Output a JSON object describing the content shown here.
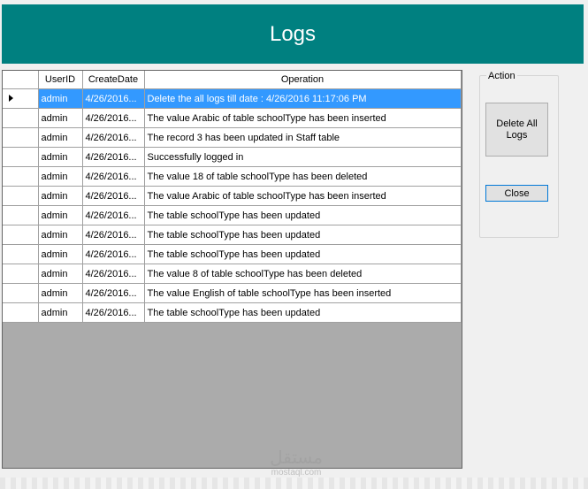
{
  "window": {
    "title": "Logs"
  },
  "grid": {
    "columns": [
      "UserID",
      "CreateDate",
      "Operation"
    ],
    "rows": [
      [
        "admin",
        "4/26/2016...",
        "Delete the all logs till date : 4/26/2016 11:17:06 PM"
      ],
      [
        "admin",
        "4/26/2016...",
        "The value Arabic of table schoolType has been inserted"
      ],
      [
        "admin",
        "4/26/2016...",
        "The record 3 has been updated in Staff table"
      ],
      [
        "admin",
        "4/26/2016...",
        "Successfully logged in"
      ],
      [
        "admin",
        "4/26/2016...",
        "The value 18 of table schoolType has been deleted"
      ],
      [
        "admin",
        "4/26/2016...",
        "The value Arabic of table schoolType has been inserted"
      ],
      [
        "admin",
        "4/26/2016...",
        "The table schoolType has been updated"
      ],
      [
        "admin",
        "4/26/2016...",
        "The table schoolType has been updated"
      ],
      [
        "admin",
        "4/26/2016...",
        "The table schoolType has been updated"
      ],
      [
        "admin",
        "4/26/2016...",
        "The value 8 of table schoolType has been deleted"
      ],
      [
        "admin",
        "4/26/2016...",
        "The value English of table schoolType has been inserted"
      ],
      [
        "admin",
        "4/26/2016...",
        "The table schoolType has been updated"
      ]
    ],
    "selected_row": 0
  },
  "action": {
    "title": "Action",
    "delete_label": "Delete All Logs",
    "close_label": "Close"
  },
  "watermark": {
    "logo": "مستقل",
    "text": "mostaql.com"
  },
  "colors": {
    "header": "#008080",
    "selection": "#3399ff"
  },
  "icons": {
    "row_indicator": "current-row-arrow-icon"
  }
}
